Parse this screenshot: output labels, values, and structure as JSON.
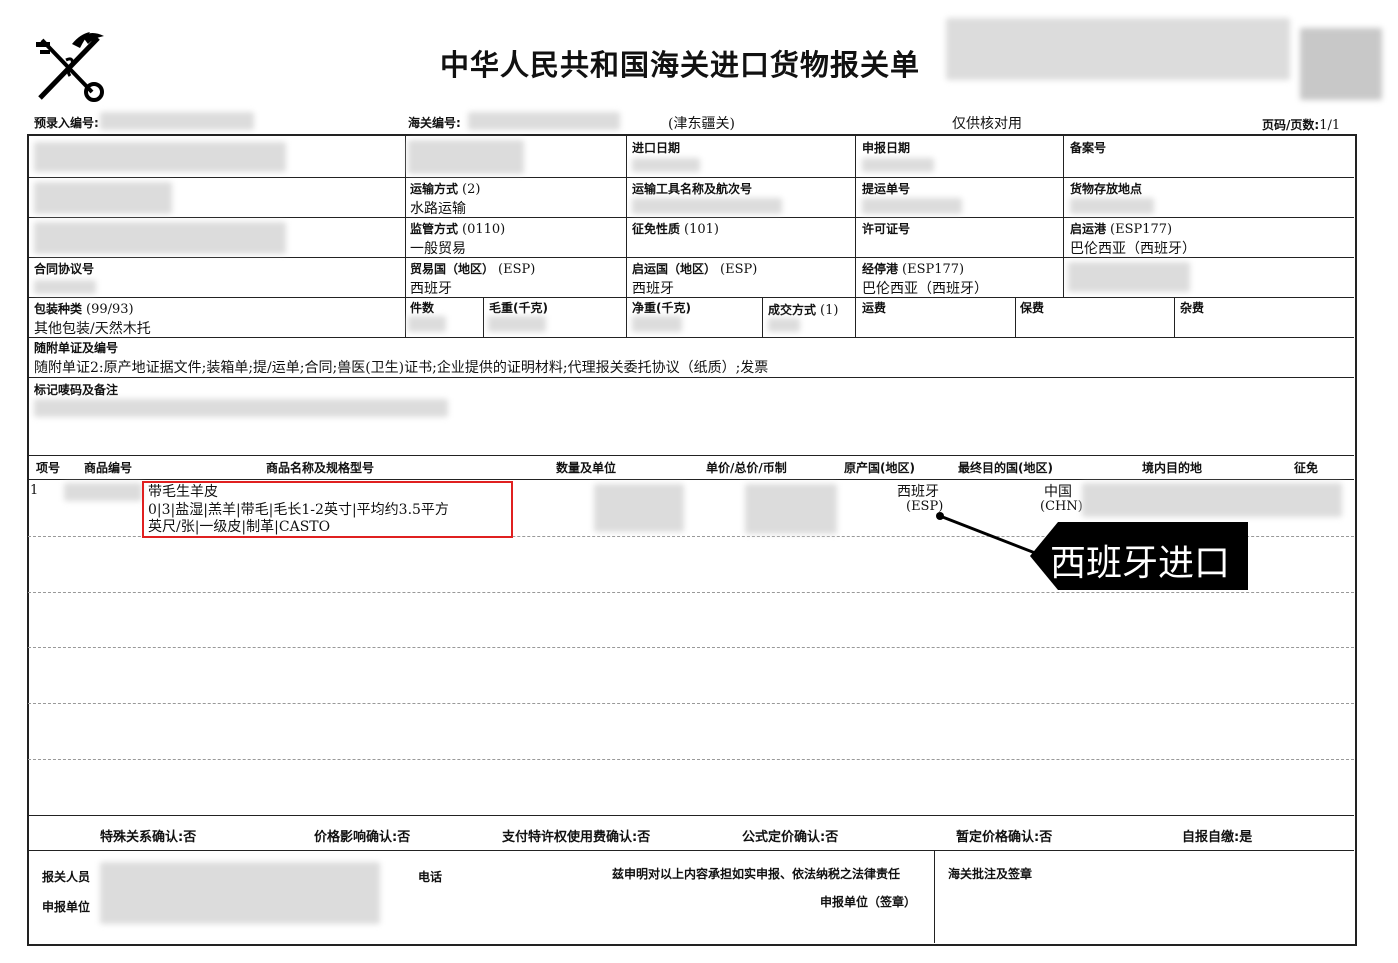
{
  "title": "中华人民共和国海关进口货物报关单",
  "header": {
    "pre_entry_label": "预录入编号:",
    "customs_no_label": "海关编号:",
    "customs_office": "(津东疆关)",
    "verify_note": "仅供核对用",
    "page_label": "页码/页数:",
    "page_value": "1/1"
  },
  "fields": {
    "import_date": "进口日期",
    "declare_date": "申报日期",
    "record_no": "备案号",
    "transport_mode_label": "运输方式",
    "transport_mode_code": "(2)",
    "transport_mode_value": "水路运输",
    "vessel_label": "运输工具名称及航次号",
    "bill_label": "提运单号",
    "storage_label": "货物存放地点",
    "supervision_label": "监管方式",
    "supervision_code": "(0110)",
    "supervision_value": "一般贸易",
    "levy_label": "征免性质",
    "levy_code": "(101)",
    "license_label": "许可证号",
    "departure_port_label": "启运港",
    "departure_port_code": "(ESP177)",
    "departure_port_value": "巴伦西亚（西班牙）",
    "contract_label": "合同协议号",
    "trade_country_label": "贸易国（地区）",
    "trade_country_code": "(ESP)",
    "trade_country_value": "西班牙",
    "origin_country_label": "启运国（地区）",
    "origin_country_code": "(ESP)",
    "origin_country_value": "西班牙",
    "transit_port_label": "经停港",
    "transit_port_code": "(ESP177)",
    "transit_port_value": "巴伦西亚（西班牙）",
    "package_label": "包装种类",
    "package_code": "(99/93)",
    "package_value": "其他包装/天然木托",
    "pieces_label": "件数",
    "gross_label": "毛重(千克)",
    "net_label": "净重(千克)",
    "deal_label": "成交方式",
    "deal_code": "(1)",
    "freight_label": "运费",
    "insurance_label": "保费",
    "misc_label": "杂费",
    "docs_label": "随附单证及编号",
    "docs_value": "随附单证2:原产地证据文件;装箱单;提/运单;合同;兽医(卫生)证书;企业提供的证明材料;代理报关委托协议（纸质）;发票",
    "marks_label": "标记唛码及备注"
  },
  "columns": [
    "项号",
    "商品编号",
    "商品名称及规格型号",
    "数量及单位",
    "单价/总价/币制",
    "原产国(地区)",
    "最终目的国(地区)",
    "境内目的地",
    "征免"
  ],
  "item": {
    "no": "1",
    "name_line1": "带毛生羊皮",
    "name_line2": "0|3|盐湿|羔羊|带毛|毛长1-2英寸|平均约3.5平方",
    "name_line3": "英尺/张|一级皮|制革|CASTO",
    "origin": "西班牙",
    "origin_code": "(ESP)",
    "destination": "中国",
    "destination_code": "(CHN)"
  },
  "annotation": "西班牙进口",
  "confirmations": {
    "special": "特殊关系确认:否",
    "price": "价格影响确认:否",
    "royalty": "支付特许权使用费确认:否",
    "formula": "公式定价确认:否",
    "provisional": "暂定价格确认:否",
    "self_pay": "自报自缴:是"
  },
  "footer": {
    "declarant": "报关人员",
    "unit": "申报单位",
    "phone": "电话",
    "statement": "兹申明对以上内容承担如实申报、依法纳税之法律责任",
    "unit_sign": "申报单位（签章）",
    "customs_sign": "海关批注及签章"
  },
  "colors": {
    "highlight_box": "#e02020",
    "callout_bg": "#000000",
    "callout_text": "#ffffff"
  }
}
